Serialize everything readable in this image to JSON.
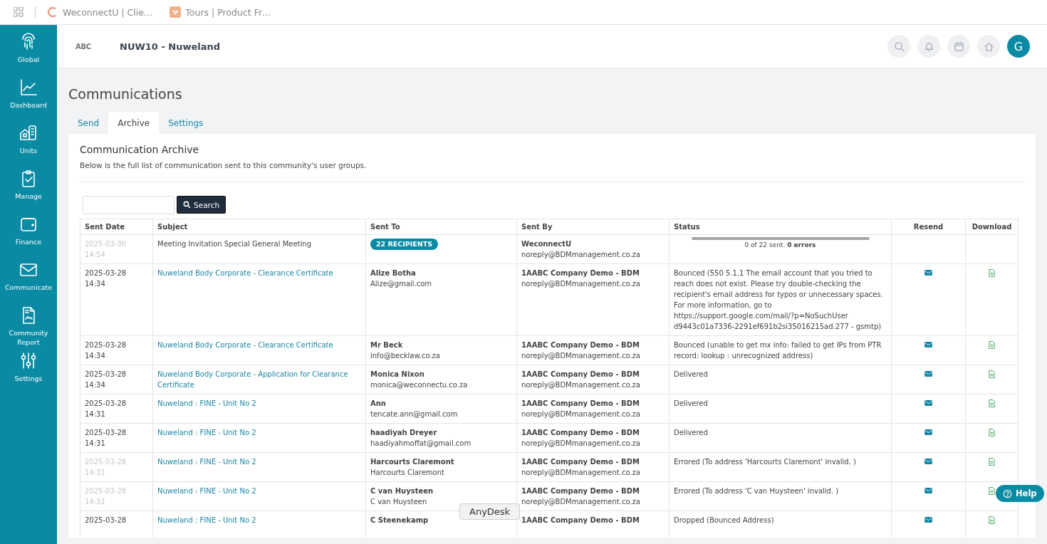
{
  "browser_tabs": [
    {
      "title": "WeconnectU | Clie…",
      "kind": "weconnect"
    },
    {
      "title": "Tours | Product Fr…",
      "kind": "tours"
    }
  ],
  "sidebar": {
    "items": [
      {
        "label": "Global",
        "kind": "fingerprint"
      },
      {
        "label": "Dashboard",
        "kind": "chart"
      },
      {
        "label": "Units",
        "kind": "building"
      },
      {
        "label": "Manage",
        "kind": "clipboard"
      },
      {
        "label": "Finance",
        "kind": "wallet"
      },
      {
        "label": "Communicate",
        "kind": "mail"
      },
      {
        "label": "Community Report",
        "kind": "report"
      },
      {
        "label": "Settings",
        "kind": "sliders"
      }
    ]
  },
  "header": {
    "logo": "ABC",
    "title": "NUW10 - Nuweland",
    "avatar": "G"
  },
  "page_title": "Communications",
  "tabs": [
    {
      "label": "Send",
      "selected": false
    },
    {
      "label": "Archive",
      "selected": true
    },
    {
      "label": "Settings",
      "selected": false
    }
  ],
  "panel": {
    "title": "Communication Archive",
    "description": "Below is the full list of communication sent to this community's user groups.",
    "search_button": "Search"
  },
  "table": {
    "columns": [
      "Sent Date",
      "Subject",
      "Sent To",
      "Sent By",
      "Status",
      "Resend",
      "Download"
    ],
    "rows": [
      {
        "date": "2025-03-30",
        "time": "14:54",
        "muted": true,
        "subject": "Meeting Invitation Special General Meeting",
        "subject_link": false,
        "recipients_badge": "22 RECIPIENTS",
        "sender": "WeconnectU",
        "sender_email": "noreply@BDMmanagement.co.za",
        "progress": {
          "level": 0,
          "text": "0 of 22 sent. **0 errors**"
        },
        "actions": false
      },
      {
        "date": "2025-03-28",
        "time": "14:34",
        "muted": false,
        "subject": "Nuweland Body Corporate - Clearance Certificate",
        "subject_link": true,
        "to_name": "Alize Botha",
        "to_email": "Alize@gmail.com",
        "sender": "1AABC Company Demo - BDM",
        "sender_email": "noreply@BDMmanagement.co.za",
        "status": "Bounced (550 5.1.1 The email account that you tried to reach does not exist. Please try double-checking the recipient's email address for typos or unnecessary spaces. For more information, go to https://support.google.com/mail/?p=NoSuchUser d9443c01a7336-2291ef691b2si35016215ad.277 - gsmtp)",
        "actions": true
      },
      {
        "date": "2025-03-28",
        "time": "14:34",
        "muted": false,
        "subject": "Nuweland Body Corporate - Clearance Certificate",
        "subject_link": true,
        "to_name": "Mr Beck",
        "to_email": "info@becklaw.co.za",
        "sender": "1AABC Company Demo - BDM",
        "sender_email": "noreply@BDMmanagement.co.za",
        "status": "Bounced (unable to get mx info: failed to get IPs from PTR record: lookup : unrecognized address)",
        "actions": true
      },
      {
        "date": "2025-03-28",
        "time": "14:34",
        "muted": false,
        "subject": "Nuweland Body Corporate - Application for Clearance Certificate",
        "subject_link": true,
        "to_name": "Monica Nixon",
        "to_email": "monica@weconnectu.co.za",
        "sender": "1AABC Company Demo - BDM",
        "sender_email": "noreply@BDMmanagement.co.za",
        "status": "Delivered",
        "actions": true
      },
      {
        "date": "2025-03-28",
        "time": "14:31",
        "muted": false,
        "subject": "Nuweland : FINE - Unit No 2",
        "subject_link": true,
        "to_name": "Ann",
        "to_email": "tencate.ann@gmail.com",
        "sender": "1AABC Company Demo - BDM",
        "sender_email": "noreply@BDMmanagement.co.za",
        "status": "Delivered",
        "actions": true
      },
      {
        "date": "2025-03-28",
        "time": "14:31",
        "muted": false,
        "subject": "Nuweland : FINE - Unit No 2",
        "subject_link": true,
        "to_name": "haadiyah Dreyer",
        "to_email": "haadiyahmoffat@gmail.com",
        "sender": "1AABC Company Demo - BDM",
        "sender_email": "noreply@BDMmanagement.co.za",
        "status": "Delivered",
        "actions": true
      },
      {
        "date": "2025-03-28",
        "time": "14:31",
        "muted": true,
        "subject": "Nuweland : FINE - Unit No 2",
        "subject_link": true,
        "to_name": "Harcourts Claremont",
        "to_email": "Harcourts Claremont",
        "sender": "1AABC Company Demo - BDM",
        "sender_email": "noreply@BDMmanagement.co.za",
        "status": "Errored (To address 'Harcourts Claremont' invalid. )",
        "actions": true
      },
      {
        "date": "2025-03-28",
        "time": "14:31",
        "muted": true,
        "subject": "Nuweland : FINE - Unit No 2",
        "subject_link": true,
        "to_name": "C van Huysteen",
        "to_email": "C van Huysteen",
        "sender": "1AABC Company Demo - BDM",
        "sender_email": "noreply@BDMmanagement.co.za",
        "status": "Errored (To address 'C van Huysteen' invalid. )",
        "actions": true
      },
      {
        "date": "2025-03-28",
        "muted": false,
        "subject": "Nuweland : FINE - Unit No 2",
        "subject_link": true,
        "to_name": "C Steenekamp",
        "sender": "1AABC Company Demo - BDM",
        "status": "Dropped (Bounced Address)",
        "actions": true
      }
    ]
  },
  "tooltip": "AnyDesk",
  "help_button": "Help"
}
